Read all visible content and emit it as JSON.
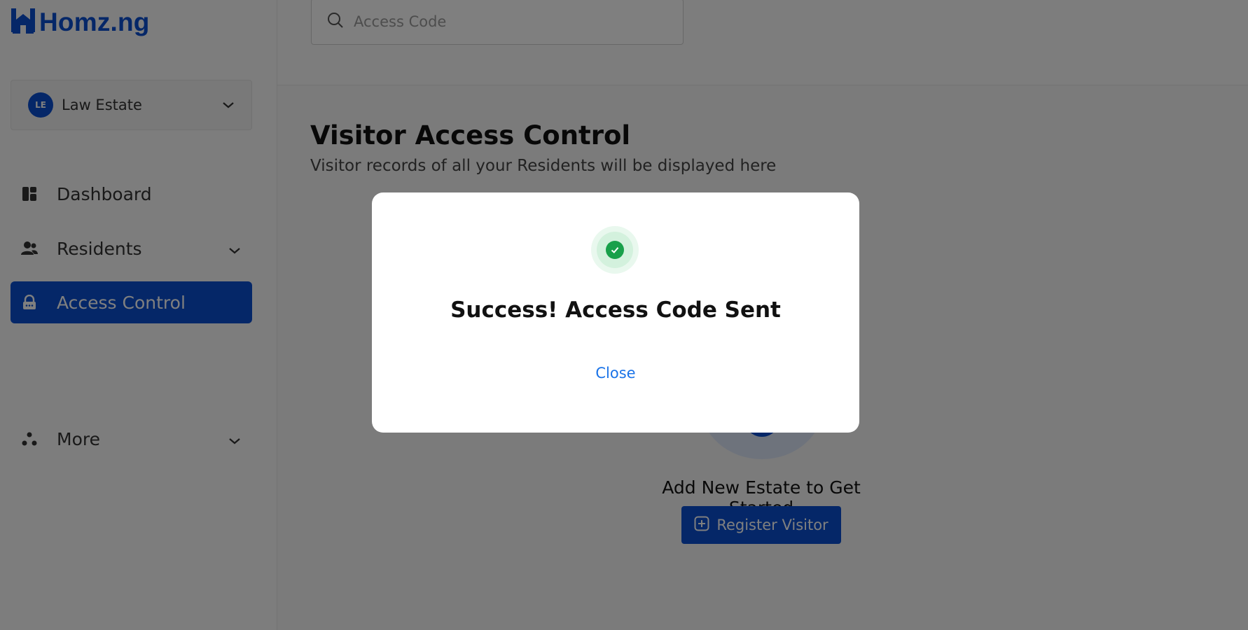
{
  "brand": {
    "logo_text": "Homz.ng",
    "accent": "#0b4fd1"
  },
  "sidebar": {
    "estate": {
      "initials": "LE",
      "name": "Law Estate"
    },
    "items": [
      {
        "label": "Dashboard",
        "icon": "dashboard-icon"
      },
      {
        "label": "Residents",
        "icon": "residents-icon"
      },
      {
        "label": "Access Control",
        "icon": "lock-icon",
        "active": true
      },
      {
        "label": "More",
        "icon": "more-icon"
      }
    ]
  },
  "search": {
    "placeholder": "Access Code"
  },
  "page": {
    "title": "Visitor Access Control",
    "subtitle": "Visitor records of all your Residents will be displayed here"
  },
  "empty_state": {
    "text": "Add New Estate to Get Started",
    "button_label": "Register Visitor"
  },
  "modal": {
    "title": "Success! Access Code Sent",
    "close_label": "Close",
    "success_color": "#18a04a"
  }
}
